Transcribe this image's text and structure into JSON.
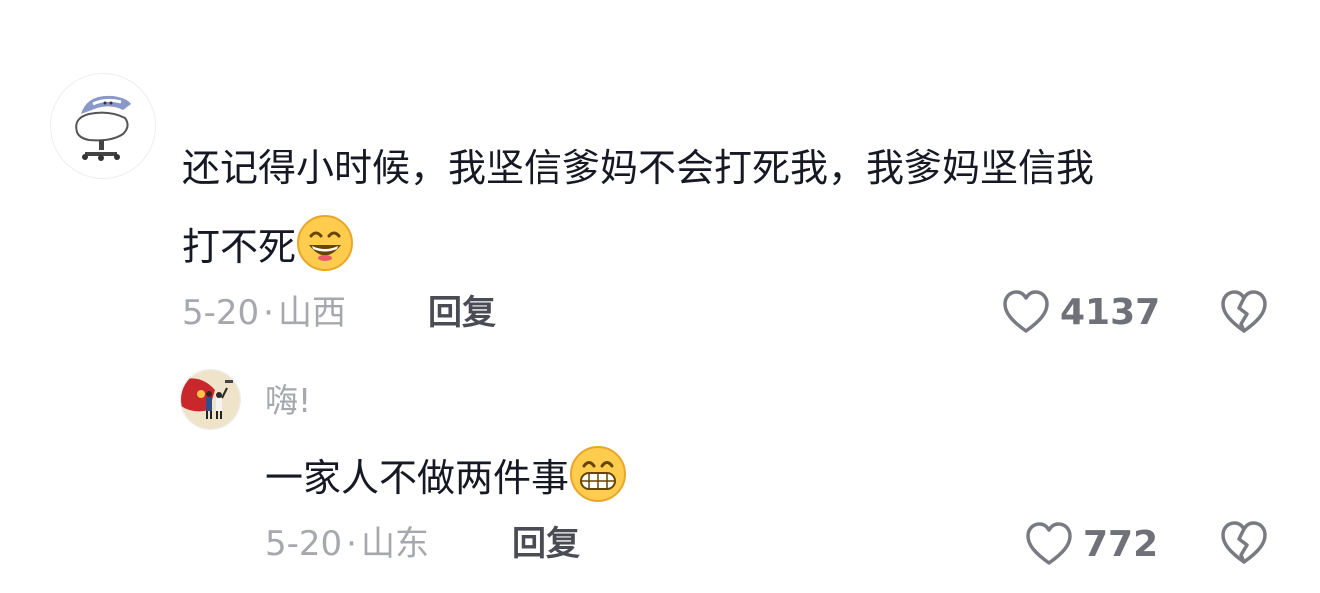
{
  "comments": [
    {
      "text_line1": "还记得小时候，我坚信爹妈不会打死我，我爹妈坚信我",
      "text_line2": "打不死",
      "emoji": "grinning-smiling-eyes-emoji",
      "date": "5-20",
      "sep": "·",
      "location": "山西",
      "reply_label": "回复",
      "like_count": "4137"
    }
  ],
  "replies": [
    {
      "username": "嗨!",
      "text": "一家人不做两件事",
      "emoji": "grinning-teeth-emoji",
      "date": "5-20",
      "sep": "·",
      "location": "山东",
      "reply_label": "回复",
      "like_count": "772"
    }
  ],
  "colors": {
    "text": "#161823",
    "meta": "#a6a8ad",
    "reply": "#4a4b54",
    "icon": "#7a7b82",
    "emoji_face": "#ffcc4d"
  },
  "icons": [
    "heart-outline-icon",
    "broken-heart-icon"
  ]
}
